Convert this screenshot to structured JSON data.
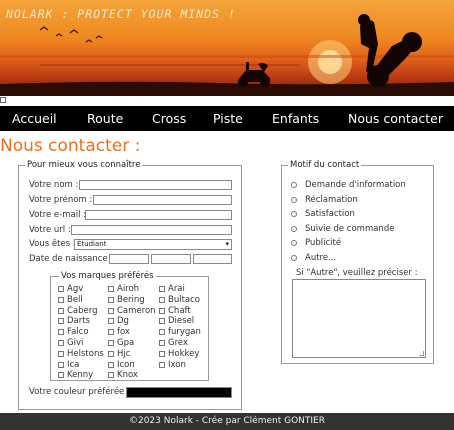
{
  "banner": {
    "title": "NOLARK : PROTECT YOUR MINDS !"
  },
  "nav": {
    "items": [
      "Accueil",
      "Route",
      "Cross",
      "Piste",
      "Enfants",
      "Nous contacter"
    ]
  },
  "page": {
    "title": "Nous contacter :"
  },
  "identity": {
    "legend": "Pour mieux vous connaître",
    "name_label": "Votre nom :",
    "firstname_label": "Votre prénom :",
    "email_label": "Votre e-mail :",
    "url_label": "Votre url :",
    "status_label": "Vous êtes :",
    "status_value": "Étudiant",
    "birth_label": "Date de naissance :",
    "color_label": "Votre couleur préférée :",
    "color_value": "#000000"
  },
  "brands": {
    "legend": "Vos marques préférés",
    "col1": [
      "Agv",
      "Bell",
      "Caberg",
      "Darts",
      "Falco",
      "Givi",
      "Helstons",
      "Ica",
      "Kenny"
    ],
    "col2": [
      "Airoh",
      "Bering",
      "Cameron",
      "Dg",
      "fox",
      "Gpa",
      "Hjc",
      "Icon",
      "Knox"
    ],
    "col3": [
      "Arai",
      "Bultaco",
      "Chaft",
      "Diesel",
      "furygan",
      "Grex",
      "Hokkey",
      "Ixon"
    ]
  },
  "motif": {
    "legend": "Motif du contact",
    "options": [
      "Demande d'information",
      "Réclamation",
      "Satisfaction",
      "Suivie de commande",
      "Publicité",
      "Autre..."
    ],
    "other_label": "Si \"Autre\", veuillez préciser :"
  },
  "footer": {
    "text": "©2023 Nolark - Crée par Clément GONTIER"
  },
  "colors": {
    "accent": "#f36d1d",
    "nav_bg": "#000000",
    "footer_bg": "#333333"
  }
}
